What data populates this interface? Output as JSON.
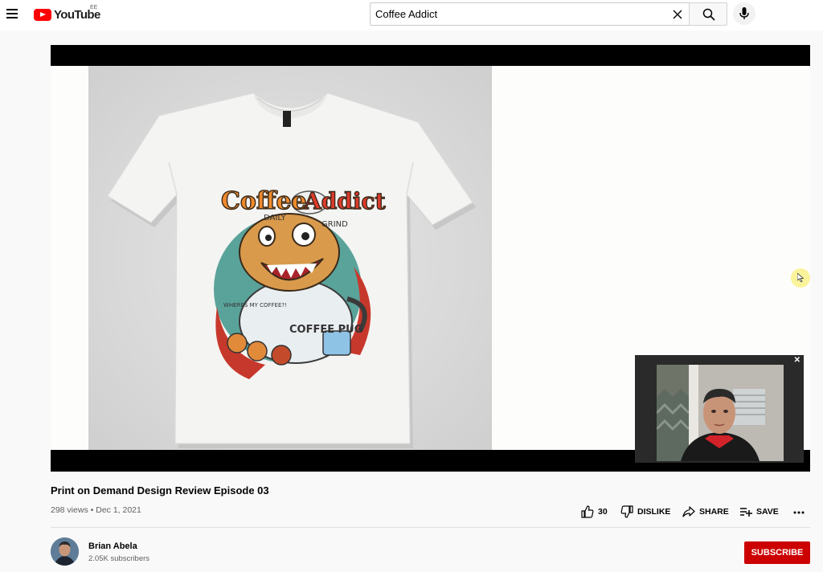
{
  "header": {
    "logo_text": "YouTube",
    "country_code": "EE",
    "search_value": "Coffee Addict"
  },
  "video": {
    "title": "Print on Demand Design Review Episode 03",
    "views": "298 views",
    "separator": "•",
    "date": "Dec 1, 2021"
  },
  "artwork": {
    "text_coffee": "Coffee",
    "text_addict": "Addict",
    "text_daily": "DAILY",
    "text_grind": "GRIND",
    "text_coffee_pug": "COFFEE PUG",
    "text_wheres": "WHERES MY COFFEE?!"
  },
  "actions": {
    "like_count": "30",
    "dislike_label": "DISLIKE",
    "share_label": "SHARE",
    "save_label": "SAVE"
  },
  "channel": {
    "name": "Brian Abela",
    "subscribers": "2.05K subscribers",
    "subscribe_label": "SUBSCRIBE"
  },
  "colors": {
    "brand_red": "#ff0000",
    "subscribe_red": "#cc0000",
    "cursor_highlight": "#fbf39b"
  },
  "icons": [
    "menu-icon",
    "youtube-logo-icon",
    "clear-icon",
    "search-icon",
    "mic-icon",
    "cursor-icon",
    "close-icon",
    "thumbs-up-icon",
    "thumbs-down-icon",
    "share-icon",
    "playlist-add-icon",
    "more-icon"
  ]
}
